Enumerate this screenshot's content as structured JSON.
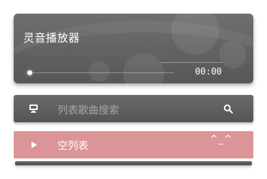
{
  "player": {
    "title": "灵音播放器",
    "time": "00:00",
    "progress": 0
  },
  "search": {
    "placeholder": "列表歌曲搜索",
    "left_icon": "monitor-icon",
    "right_icon": "search-icon"
  },
  "playlist": {
    "icon": "play-icon",
    "label": "空列表",
    "emoticon": "^_^"
  },
  "colors": {
    "player_bg": "#5f5f5f",
    "search_bg": "#5e5e5e",
    "playlist_bg": "#db9596",
    "placeholder_text": "#a7a7a7"
  }
}
